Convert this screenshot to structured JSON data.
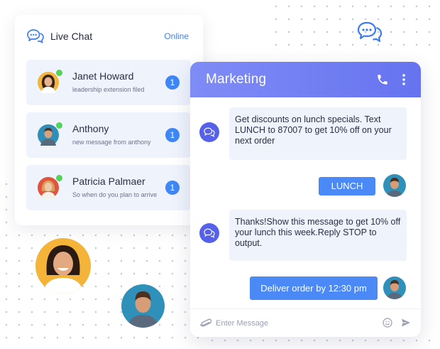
{
  "live_chat": {
    "title": "Live Chat",
    "status": "Online",
    "contacts": [
      {
        "name": "Janet Howard",
        "message": "leadership extension filed",
        "unread": "1",
        "online": true
      },
      {
        "name": "Anthony",
        "message": "new message from anthony",
        "unread": "1",
        "online": true
      },
      {
        "name": "Patricia Palmaer",
        "message": "So when do you plan to arrive",
        "unread": "1",
        "online": true
      }
    ]
  },
  "chat": {
    "title": "Marketing",
    "messages": [
      {
        "from": "bot",
        "text": "Get discounts on lunch specials. Text LUNCH to 87007 to get 10% off on your next order"
      },
      {
        "from": "user",
        "text": "LUNCH"
      },
      {
        "from": "bot",
        "text": "Thanks!Show this message to get 10% off your lunch this week.Reply STOP to output."
      },
      {
        "from": "user",
        "text": "Deliver order by 12:30 pm"
      }
    ],
    "input_placeholder": "Enter Message"
  },
  "colors": {
    "accent": "#4b8af6",
    "header_gradient": [
      "#7f8cf6",
      "#6673f0"
    ],
    "online": "#52d35a",
    "bubble_bg": "#eef3fc"
  },
  "icons": {
    "header": "chat-bubbles-icon",
    "call": "phone-icon",
    "menu": "more-vertical-icon",
    "attach": "paperclip-icon",
    "emoji": "smiley-icon",
    "send": "send-icon"
  }
}
